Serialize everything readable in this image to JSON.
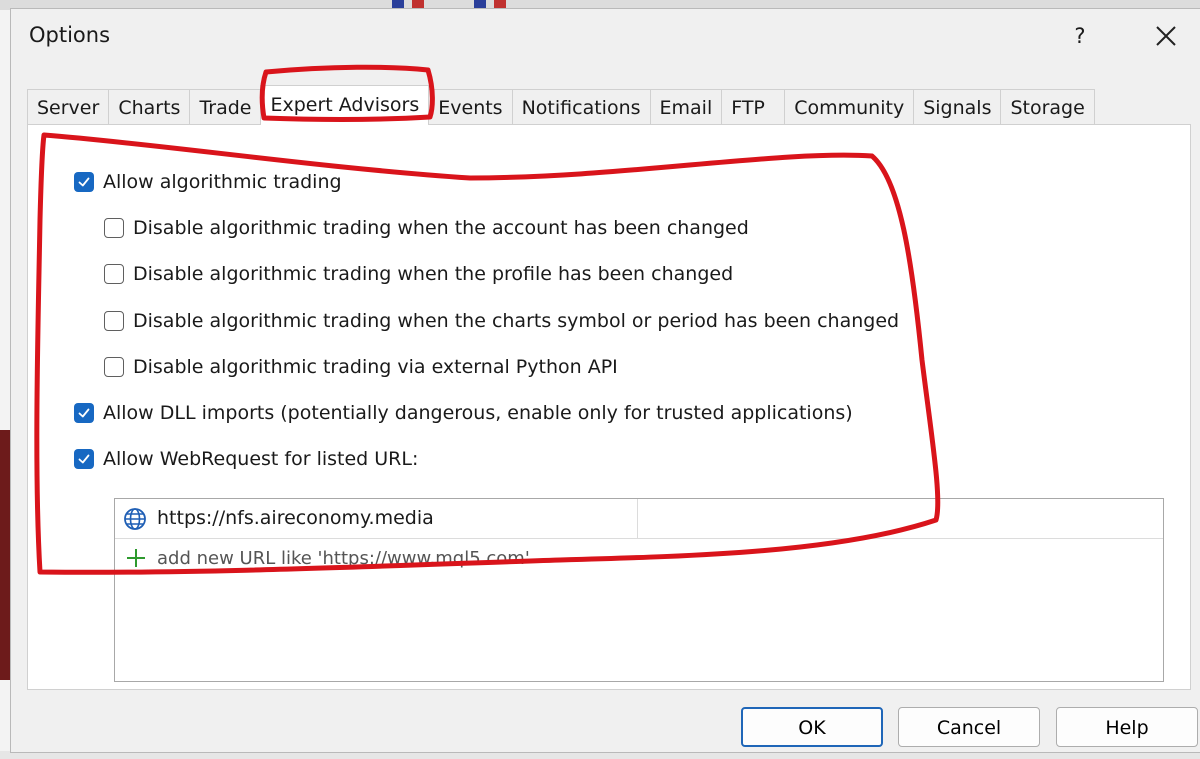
{
  "window": {
    "title": "Options",
    "help_glyph": "?",
    "close_glyph": "×"
  },
  "tabs": [
    {
      "label": "Server"
    },
    {
      "label": "Charts"
    },
    {
      "label": "Trade"
    },
    {
      "label": "Expert Advisors",
      "active": true
    },
    {
      "label": "Events"
    },
    {
      "label": "Notifications"
    },
    {
      "label": "Email"
    },
    {
      "label": "FTP"
    },
    {
      "label": "Community"
    },
    {
      "label": "Signals"
    },
    {
      "label": "Storage"
    }
  ],
  "options": {
    "allow_algo": {
      "label": "Allow algorithmic trading",
      "checked": true
    },
    "disable_account": {
      "label": "Disable algorithmic trading when the account has been changed",
      "checked": false
    },
    "disable_profile": {
      "label": "Disable algorithmic trading when the profile has been changed",
      "checked": false
    },
    "disable_symbol": {
      "label": "Disable algorithmic trading when the charts symbol or period has been changed",
      "checked": false
    },
    "disable_python": {
      "label": "Disable algorithmic trading via external Python API",
      "checked": false
    },
    "allow_dll": {
      "label": "Allow DLL imports (potentially dangerous, enable only for trusted applications)",
      "checked": true
    },
    "allow_webrequest": {
      "label": "Allow WebRequest for listed URL:",
      "checked": true
    }
  },
  "url_list": {
    "urls": [
      "https://nfs.aireconomy.media"
    ],
    "add_placeholder": "add new URL like 'https://www.mql5.com'"
  },
  "buttons": {
    "ok": "OK",
    "cancel": "Cancel",
    "help": "Help"
  },
  "colors": {
    "accent": "#1768c2",
    "annotation": "#d9141b",
    "add_icon": "#2e9a2e"
  }
}
